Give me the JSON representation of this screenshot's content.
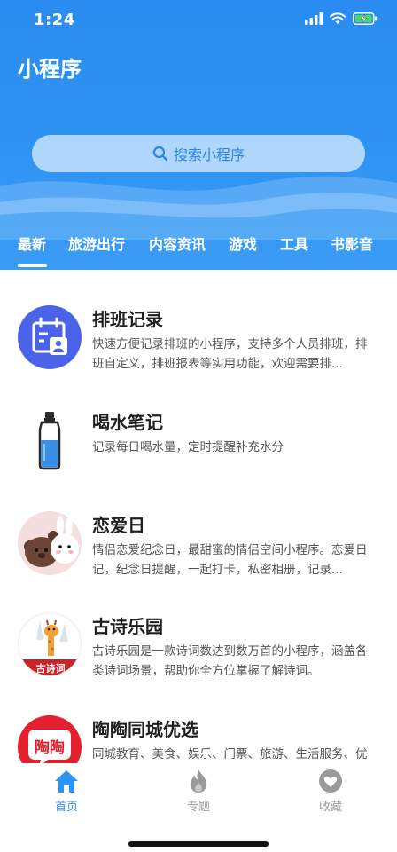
{
  "status_bar": {
    "time": "1:24"
  },
  "header": {
    "title": "小程序",
    "search_placeholder": "搜索小程序"
  },
  "tabs": [
    {
      "label": "最新",
      "active": true
    },
    {
      "label": "旅游出行",
      "active": false
    },
    {
      "label": "内容资讯",
      "active": false
    },
    {
      "label": "游戏",
      "active": false
    },
    {
      "label": "工具",
      "active": false
    },
    {
      "label": "书影音",
      "active": false
    }
  ],
  "apps": [
    {
      "name": "排班记录",
      "description": "快速方便记录排班的小程序，支持多个人员排班，排班自定义，排班报表等实用功能，欢迎需要排...",
      "icon": "calendar-person-icon"
    },
    {
      "name": "喝水笔记",
      "description": "记录每日喝水量，定时提醒补充水分",
      "icon": "water-bottle-icon"
    },
    {
      "name": "恋爱日",
      "description": "情侣恋爱纪念日，最甜蜜的情侣空间小程序。恋爱日记，纪念日提醒，一起打卡，私密相册，记录...",
      "icon": "couple-bears-icon"
    },
    {
      "name": "古诗乐园",
      "description": "古诗乐园是一款诗词数达到数万首的小程序，涵盖各类诗词场景，帮助你全方位掌握了解诗词。",
      "icon": "giraffe-poem-icon",
      "badge_text": "古诗词"
    },
    {
      "name": "陶陶同城优选",
      "description": "同城教育、美食、娱乐、门票、旅游、生活服务、优惠信息发布平台",
      "icon": "taotao-logo-icon",
      "logo_text": "陶陶"
    }
  ],
  "tabbar": [
    {
      "label": "首页",
      "icon": "home-icon",
      "active": true
    },
    {
      "label": "专题",
      "icon": "flame-icon",
      "active": false
    },
    {
      "label": "收藏",
      "icon": "heart-icon",
      "active": false
    }
  ],
  "colors": {
    "primary": "#2f93f3",
    "inactive": "#9a9a9a"
  }
}
